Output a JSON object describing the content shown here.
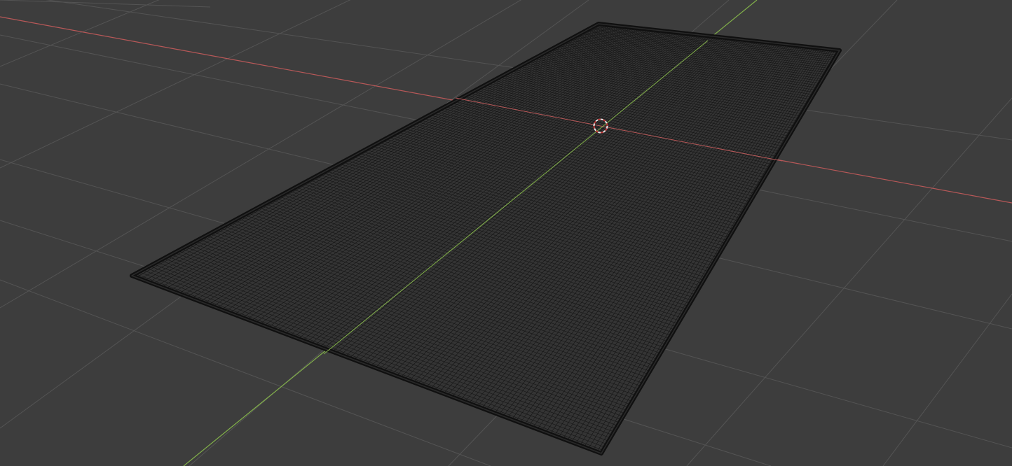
{
  "app": {
    "title": ""
  },
  "viewport": {
    "mode": "wireframe",
    "background": "#3d3d3d",
    "grid_color": "#545454",
    "x_axis_color": "#b85858",
    "y_axis_color": "#82b04a",
    "wire_color": "#151515",
    "cursor_color": "#e7e7e7",
    "cursor_accent": "#c23b3b",
    "objects": [
      {
        "type": "plane",
        "name": "",
        "modifier": "subdivision"
      }
    ]
  }
}
